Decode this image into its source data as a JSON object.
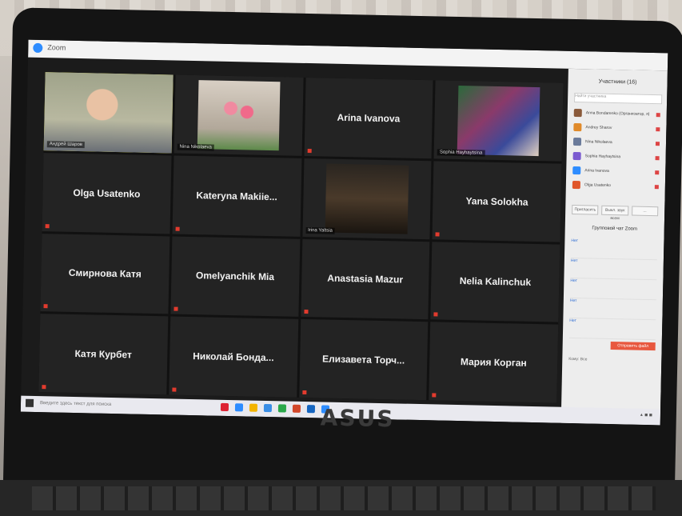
{
  "window": {
    "title": "Zoom"
  },
  "participants_grid": [
    {
      "label": "Андрей Шаров",
      "has_video": true,
      "active": true,
      "video_kind": "person"
    },
    {
      "label": "Nina Nikolaeva",
      "has_video": true,
      "active": false,
      "video_kind": "flowers"
    },
    {
      "label": "Arina Ivanova",
      "has_video": false,
      "active": false
    },
    {
      "label": "Sophia Hayhaytsina",
      "has_video": true,
      "active": false,
      "video_kind": "painting"
    },
    {
      "label": "Olga Usatenko",
      "has_video": false,
      "active": false
    },
    {
      "label": "Kateryna Makiie...",
      "has_video": false,
      "active": false
    },
    {
      "label": "Irina Yaltsia",
      "has_video": true,
      "active": false,
      "video_kind": "room"
    },
    {
      "label": "Yana Solokha",
      "has_video": false,
      "active": false
    },
    {
      "label": "Смирнова Катя",
      "has_video": false,
      "active": false
    },
    {
      "label": "Omelyanchik Mia",
      "has_video": false,
      "active": false
    },
    {
      "label": "Anastasia Mazur",
      "has_video": false,
      "active": false
    },
    {
      "label": "Nelia Kalinchuk",
      "has_video": false,
      "active": false
    },
    {
      "label": "Катя Курбет",
      "has_video": false,
      "active": false
    },
    {
      "label": "Николай Бонда...",
      "has_video": false,
      "active": false
    },
    {
      "label": "Елизавета Торч...",
      "has_video": false,
      "active": false
    },
    {
      "label": "Мария Корган",
      "has_video": false,
      "active": false
    }
  ],
  "side_panel": {
    "title": "Участники (16)",
    "search_placeholder": "Найти участника",
    "participants": [
      {
        "name": "Anna Bondarenko (Организатор, я)",
        "color": "#8a5a3a"
      },
      {
        "name": "Andrey Sharov",
        "color": "#e08a2a"
      },
      {
        "name": "Nina Nikolaeva",
        "color": "#6a7a9a"
      },
      {
        "name": "Sophia Hayhaytsina",
        "color": "#7a5ad0"
      },
      {
        "name": "Arina Ivanova",
        "color": "#2d8cff"
      },
      {
        "name": "Olga Usatenko",
        "color": "#e0562a"
      }
    ],
    "buttons": [
      "Пригласить",
      "Выкл. звук всем",
      "..."
    ],
    "chat_title": "Групповой чат Zoom",
    "messages": [
      "Нет",
      "Нет",
      "Нет",
      "Нет",
      "Нет"
    ],
    "send_label": "Отправить файл",
    "input_label": "Кому: Все"
  },
  "taskbar": {
    "search_placeholder": "Введите здесь текст для поиска",
    "icon_colors": [
      "#d23",
      "#2d8cff",
      "#f3b400",
      "#3a8ee6",
      "#2aa84a",
      "#d2472a",
      "#1565c0",
      "#2d8cff"
    ]
  },
  "laptop": {
    "brand": "ASUS"
  }
}
